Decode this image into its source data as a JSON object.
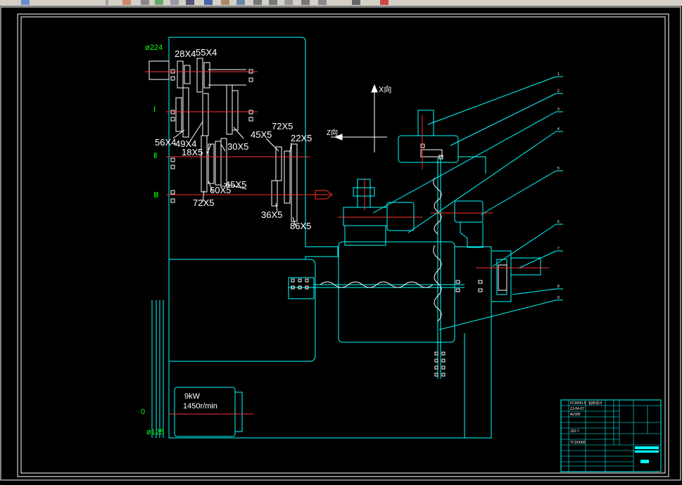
{
  "toolbar": {
    "icons": [
      "app-icon",
      "view-icon",
      "draw-icon",
      "wrench-icon",
      "layers-icon",
      "copy-icon",
      "arrow-down-icon",
      "refresh-icon",
      "properties-icon",
      "zoom-icon",
      "rotate-left-icon",
      "rotate-right-icon",
      "window-icon",
      "grid-icon",
      "paste-icon",
      "pen-icon",
      "flag-icon"
    ]
  },
  "drawing": {
    "gears": {
      "g28x4": "28X4",
      "g55x4": "55X4",
      "g56x4": "56X4",
      "g49x4": "49X4",
      "g18x5": "18X5",
      "g30x5": "30X5",
      "g45x5a": "45X5",
      "g72x5a": "72X5",
      "g22x5": "22X5",
      "g45x5b": "45X5",
      "g60x5": "60X5",
      "g72x5b": "72X5",
      "g36x5": "36X5",
      "g86x5": "86X5"
    },
    "pulley_top": "ø224",
    "pulley_bottom": "ø125",
    "shaft_marks": [
      "Ⅰ",
      "Ⅱ",
      "Ⅲ"
    ],
    "bottom_mark": "0",
    "motor_power": "9kW",
    "motor_speed": "1450r/min",
    "axis_x": "X向",
    "axis_z": "Z向",
    "leader_numbers": [
      "1",
      "2",
      "3",
      "4",
      "5",
      "6",
      "7",
      "8",
      "9"
    ]
  },
  "title_block": {
    "rows": [
      "FC0000-S",
      "ZJ-04-07",
      "AL600",
      "",
      "",
      "",
      "J20-T",
      "",
      "TCD0000",
      "",
      ""
    ],
    "cols": [
      "钻床设计",
      "",
      "",
      "",
      "",
      "",
      "",
      "",
      ""
    ]
  },
  "colors": {
    "background": "#000000",
    "frame": "#ffffff",
    "outline": "#00ffff",
    "centerline": "#ff0000",
    "green": "#00ff00",
    "white": "#ffffff"
  }
}
